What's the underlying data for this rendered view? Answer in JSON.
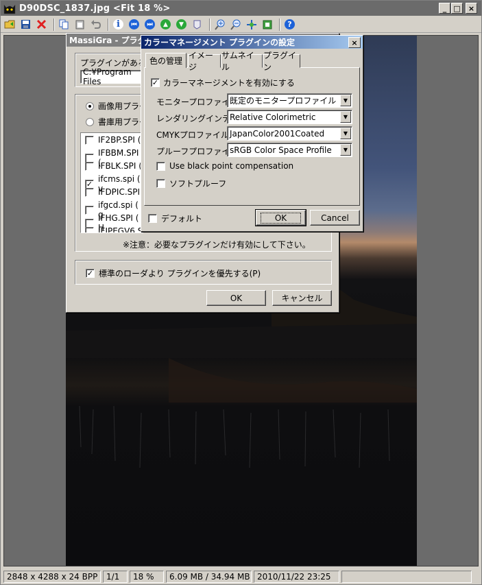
{
  "window": {
    "title": "D90DSC_1837.jpg <Fit 18 %>",
    "min_label": "_",
    "max_label": "□",
    "close_label": "×"
  },
  "toolbar": {
    "icons": [
      "open-icon",
      "save-icon",
      "delete-icon",
      "copy-icon",
      "paste-icon",
      "undo-icon",
      "info-icon",
      "first-icon",
      "last-icon",
      "prev-icon",
      "next-icon",
      "bookmark-icon",
      "zoom-in-icon",
      "zoom-out-icon",
      "fit-icon",
      "fullscreen-icon",
      "help-icon"
    ]
  },
  "status": {
    "dimensions": "2848 x 4288 x 24 BPP",
    "page": "1/1",
    "zoom": "18 %",
    "memory": "6.09 MB / 34.94 MB",
    "datetime": "2010/11/22 23:25"
  },
  "plugin_dialog": {
    "title": "MassiGra - プラグイ",
    "folder_label": "プラグインがあるフォ",
    "folder_value": "C:¥Program Files",
    "radio_image": "画像用プラグ",
    "radio_archive": "書庫用プラグ",
    "plugins": [
      {
        "name": "IF2BP.SPI (",
        "checked": false
      },
      {
        "name": "IFBBM.SPI (",
        "checked": false
      },
      {
        "name": "IFBLK.SPI (",
        "checked": false
      },
      {
        "name": "ifcms.spi ( v",
        "checked": true
      },
      {
        "name": "IFDPIC.SPI",
        "checked": false
      },
      {
        "name": "ifgcd.spi ( g",
        "checked": false
      },
      {
        "name": "IFHG.SPI ( H",
        "checked": false
      },
      {
        "name": "IFJPEGV6.S",
        "checked": false
      }
    ],
    "note": "※注意：必要なプラグインだけ有効にして下さい。",
    "prefer_label": "標準のローダより プラグインを優先する(P)",
    "prefer_checked": true,
    "ok": "OK",
    "cancel": "キャンセル"
  },
  "cm_dialog": {
    "title": "カラーマネージメント プラグインの設定",
    "close_label": "×",
    "tabs": [
      "色の管理",
      "イメージ",
      "サムネイル",
      "プラグイン"
    ],
    "enable_label": "カラーマネージメントを有効にする",
    "enable_checked": true,
    "fields": [
      {
        "label": "モニタープロファイル",
        "value": "既定のモニタープロファイル"
      },
      {
        "label": "レンダリングインテント",
        "value": "Relative Colorimetric"
      },
      {
        "label": "CMYKプロファイル",
        "value": "JapanColor2001Coated"
      },
      {
        "label": "プルーフプロファイル",
        "value": "sRGB Color Space Profile"
      }
    ],
    "black_point_label": "Use black point compensation",
    "softproof_label": "ソフトプルーフ",
    "default_label": "デフォルト",
    "ok": "OK",
    "cancel": "Cancel"
  }
}
